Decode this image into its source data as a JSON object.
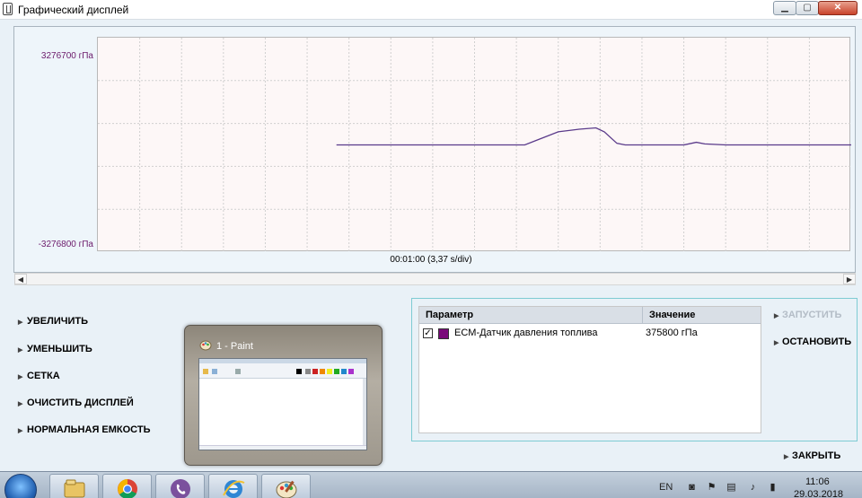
{
  "window": {
    "title": "Графический дисплей",
    "controls": {
      "minimize": "▁",
      "maximize": "▢",
      "close": "✕"
    }
  },
  "graph": {
    "y_max_label": "3276700 гПа",
    "y_min_label": "-3276800 гПа",
    "x_caption": "00:01:00 (3,37 s/div)",
    "line_color": "#5a3a8a",
    "grid_color": "#d0d0d0"
  },
  "chart_data": {
    "type": "line",
    "title": "",
    "xlabel": "00:01:00 (3,37 s/div)",
    "ylabel": "",
    "ylim": [
      -3276800,
      3276700
    ],
    "x_divisions": 18,
    "y_divisions": 5,
    "grid": true,
    "series": [
      {
        "color": "#5a3a8a",
        "x": [
          5.7,
          7.0,
          9.0,
          10.2,
          10.5,
          10.7,
          11.0,
          11.5,
          11.9,
          12.1,
          12.4,
          12.6,
          13.0,
          14.0,
          14.3,
          14.5,
          15.0,
          15.8,
          16.5,
          17.5,
          18.0
        ],
        "y": [
          0,
          0,
          0,
          0,
          150000,
          250000,
          400000,
          480000,
          520000,
          400000,
          50000,
          0,
          0,
          0,
          80000,
          30000,
          0,
          0,
          0,
          0,
          0
        ]
      }
    ]
  },
  "left_commands": [
    "УВЕЛИЧИТЬ",
    "УМЕНЬШИТЬ",
    "СЕТКА",
    "ОЧИСТИТЬ ДИСПЛЕЙ",
    "НОРМАЛЬНАЯ ЕМКОСТЬ"
  ],
  "preview": {
    "title": "1 - Paint"
  },
  "params": {
    "header_param": "Параметр",
    "header_value": "Значение",
    "rows": [
      {
        "checked": "✓",
        "name": "ECM-Датчик давления топлива",
        "value": "375800 гПа",
        "color": "#7a0a7a"
      }
    ]
  },
  "right_commands": {
    "start": "ЗАПУСТИТЬ",
    "stop": "ОСТАНОВИТЬ",
    "close": "ЗАКРЫТЬ"
  },
  "taskbar": {
    "items": [
      "explorer-icon",
      "chrome-icon",
      "viber-icon",
      "ie-icon",
      "paint-icon"
    ],
    "language": "EN",
    "time": "11:06",
    "date": "29.03.2018"
  }
}
